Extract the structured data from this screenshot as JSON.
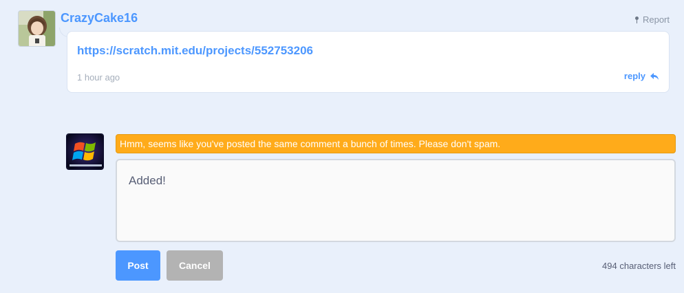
{
  "comment": {
    "username": "CrazyCake16",
    "report_label": "Report",
    "link_text": "https://scratch.mit.edu/projects/552753206",
    "timestamp": "1 hour ago",
    "reply_label": "reply"
  },
  "composer": {
    "alert_text": "Hmm, seems like you've posted the same comment a bunch of times. Please don't spam.",
    "textarea_value": "Added!",
    "post_label": "Post",
    "cancel_label": "Cancel",
    "chars_left": "494 characters left"
  },
  "colors": {
    "accent": "#4c97ff",
    "alert": "#ffab1a",
    "background": "#e9f0fb"
  },
  "icons": {
    "report": "report-pin-icon",
    "reply": "reply-arrow-icon"
  }
}
